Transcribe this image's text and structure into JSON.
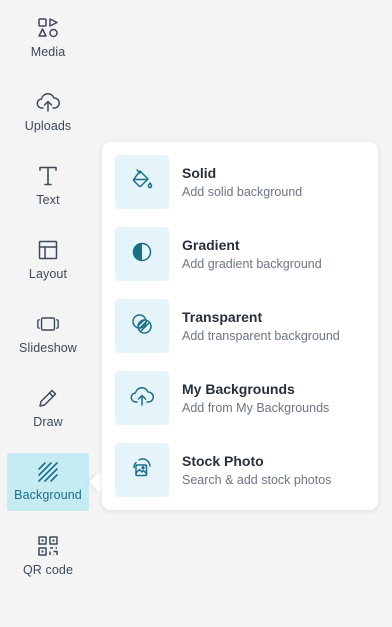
{
  "sidebar": {
    "items": [
      {
        "label": "Media",
        "icon": "media-icon"
      },
      {
        "label": "Uploads",
        "icon": "upload-cloud-icon"
      },
      {
        "label": "Text",
        "icon": "text-icon"
      },
      {
        "label": "Layout",
        "icon": "layout-icon"
      },
      {
        "label": "Slideshow",
        "icon": "slideshow-icon"
      },
      {
        "label": "Draw",
        "icon": "pencil-icon"
      },
      {
        "label": "Background",
        "icon": "background-icon",
        "active": true
      },
      {
        "label": "QR code",
        "icon": "qr-code-icon"
      }
    ]
  },
  "background_menu": {
    "options": [
      {
        "title": "Solid",
        "description": "Add solid background",
        "icon": "paint-bucket-icon"
      },
      {
        "title": "Gradient",
        "description": "Add gradient background",
        "icon": "gradient-circle-icon"
      },
      {
        "title": "Transparent",
        "description": "Add transparent background",
        "icon": "transparent-circles-icon"
      },
      {
        "title": "My Backgrounds",
        "description": "Add from My Backgrounds",
        "icon": "upload-cloud-icon"
      },
      {
        "title": "Stock Photo",
        "description": "Search & add stock photos",
        "icon": "image-search-icon"
      }
    ]
  },
  "colors": {
    "accent": "#1b6f86",
    "active_bg": "#c5ecf3",
    "tile_bg": "#e4f4f8",
    "sidebar_icon": "#3c4a5a"
  }
}
